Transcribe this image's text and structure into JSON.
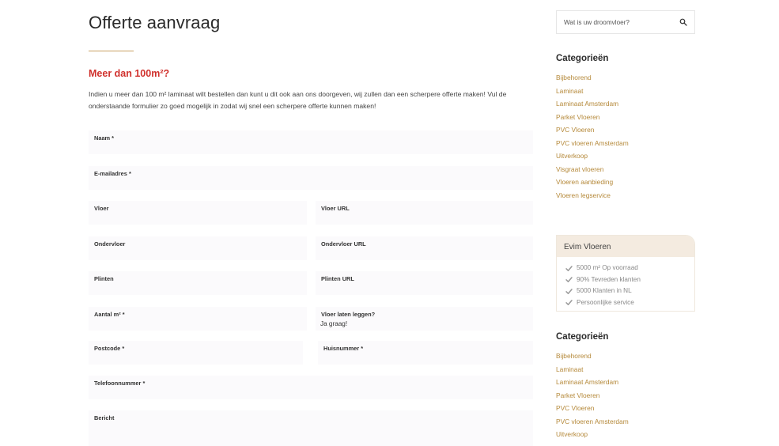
{
  "page": {
    "title": "Offerte aanvraag",
    "subhead": "Meer dan 100m²?",
    "intro": "Indien u meer dan 100 m² laminaat wilt bestellen dan kunt u dit ook aan ons doorgeven, wij zullen dan een scherpere offerte maken! Vul de onderstaande formulier zo goed mogelijk in zodat wij snel een scherpere offerte kunnen maken!"
  },
  "form": {
    "naam": {
      "label": "Naam *",
      "value": ""
    },
    "email": {
      "label": "E-mailadres *",
      "value": ""
    },
    "vloer": {
      "label": "Vloer",
      "value": ""
    },
    "vloer_url": {
      "label": "Vloer URL",
      "value": ""
    },
    "ondervloer": {
      "label": "Ondervloer",
      "value": ""
    },
    "ondervloer_url": {
      "label": "Ondervloer URL",
      "value": ""
    },
    "plinten": {
      "label": "Plinten",
      "value": ""
    },
    "plinten_url": {
      "label": "Plinten URL",
      "value": ""
    },
    "aantal": {
      "label": "Aantal m² *",
      "value": ""
    },
    "leggen": {
      "label": "Vloer laten leggen?",
      "value": "Ja graag!"
    },
    "postcode": {
      "label": "Postcode *",
      "value": ""
    },
    "huisnummer": {
      "label": "Huisnummer *",
      "value": ""
    },
    "telefoon": {
      "label": "Telefoonnummer *",
      "value": ""
    },
    "bericht": {
      "label": "Bericht",
      "value": ""
    }
  },
  "sidebar": {
    "search": {
      "placeholder": "Wat is uw droomvloer?",
      "icon": "search-icon"
    },
    "categories_title": "Categorieën",
    "categories": [
      "Bijbehorend",
      "Laminaat",
      "Laminaat Amsterdam",
      "Parket Vloeren",
      "PVC Vloeren",
      "PVC vloeren Amsterdam",
      "Uitverkoop",
      "Visgraat vloeren",
      "Vloeren aanbieding",
      "Vloeren legservice"
    ],
    "usp": {
      "title": "Evim Vloeren",
      "items": [
        "5000 m² Op voorraad",
        "90% Tevreden klanten",
        "5000 Klanten in NL",
        "Persoonlijke service"
      ]
    },
    "categories2_title": "Categorieën",
    "categories2": [
      "Bijbehorend",
      "Laminaat",
      "Laminaat Amsterdam",
      "Parket Vloeren",
      "PVC Vloeren",
      "PVC vloeren Amsterdam",
      "Uitverkoop"
    ]
  },
  "colors": {
    "accent": "#c9a063",
    "link": "#b5893a",
    "subhead": "#d0312d",
    "usp_header": "#f4ebe0"
  }
}
